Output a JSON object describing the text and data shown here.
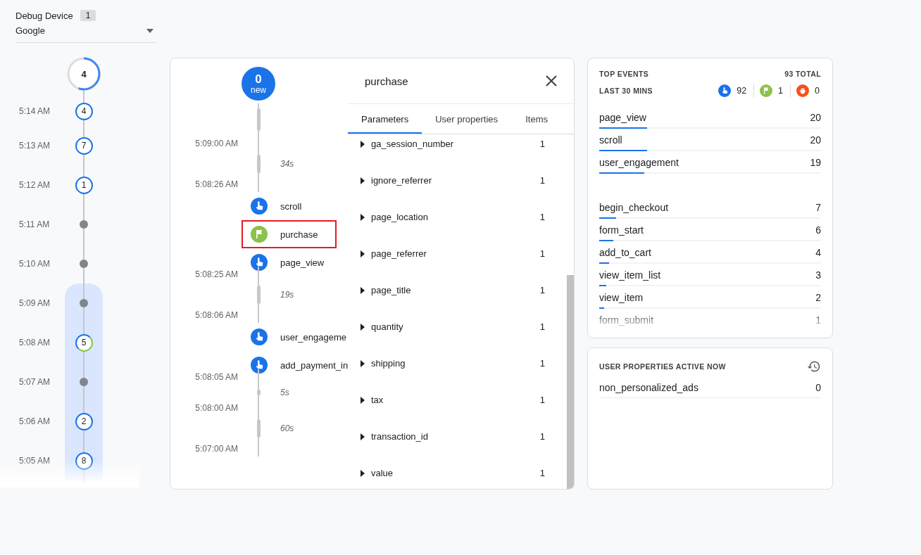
{
  "device": {
    "label": "Debug Device",
    "count": "1",
    "selection": "Google"
  },
  "countdown": {
    "count": "4",
    "level": 0.55
  },
  "minutes": [
    {
      "time": "5:14 AM",
      "kind": "count",
      "count": "4",
      "conversion": false,
      "selected": false
    },
    {
      "time": "5:13 AM",
      "kind": "count",
      "count": "7",
      "conversion": false,
      "selected": false
    },
    {
      "time": "5:12 AM",
      "kind": "count",
      "count": "1",
      "conversion": false,
      "selected": false
    },
    {
      "time": "5:11 AM",
      "kind": "empty",
      "selected": false
    },
    {
      "time": "5:10 AM",
      "kind": "empty",
      "selected": false
    },
    {
      "time": "5:09 AM",
      "kind": "empty",
      "selected": true
    },
    {
      "time": "5:08 AM",
      "kind": "count",
      "count": "5",
      "conversion": true,
      "selected": true
    },
    {
      "time": "5:07 AM",
      "kind": "empty",
      "selected": true
    },
    {
      "time": "5:06 AM",
      "kind": "count",
      "count": "2",
      "conversion": false,
      "selected": true
    },
    {
      "time": "5:05 AM",
      "kind": "count",
      "count": "8",
      "conversion": false,
      "selected": true
    }
  ],
  "stream": {
    "new_count": "0",
    "new_label": "new",
    "entries": [
      {
        "kind": "gap"
      },
      {
        "kind": "time",
        "text": "5:09:00 AM"
      },
      {
        "kind": "gap",
        "text": "34s"
      },
      {
        "kind": "time",
        "text": "5:08:26 AM"
      },
      {
        "kind": "event",
        "name": "scroll",
        "selected": false
      },
      {
        "kind": "conversion",
        "name": "purchase",
        "selected": true
      },
      {
        "kind": "event",
        "name": "page_view",
        "selected": false
      },
      {
        "kind": "time",
        "text": "5:08:25 AM"
      },
      {
        "kind": "gap",
        "text": "19s"
      },
      {
        "kind": "time",
        "text": "5:08:06 AM"
      },
      {
        "kind": "event",
        "name": "user_engageme",
        "selected": false
      },
      {
        "kind": "event",
        "name": "add_payment_in",
        "selected": false
      },
      {
        "kind": "time",
        "text": "5:08:05 AM"
      },
      {
        "kind": "short_gap",
        "text": "5s"
      },
      {
        "kind": "time",
        "text": "5:08:00 AM"
      },
      {
        "kind": "gap",
        "text": "60s"
      },
      {
        "kind": "time",
        "text": "5:07:00 AM"
      }
    ]
  },
  "detail": {
    "title": "purchase",
    "tabs": [
      {
        "label": "Parameters",
        "selected": true
      },
      {
        "label": "User properties",
        "selected": false
      },
      {
        "label": "Items",
        "selected": false
      }
    ],
    "parameters": [
      {
        "name": "ga_session_number",
        "value": "1"
      },
      {
        "name": "ignore_referrer",
        "value": "1"
      },
      {
        "name": "page_location",
        "value": "1"
      },
      {
        "name": "page_referrer",
        "value": "1"
      },
      {
        "name": "page_title",
        "value": "1"
      },
      {
        "name": "quantity",
        "value": "1"
      },
      {
        "name": "shipping",
        "value": "1"
      },
      {
        "name": "tax",
        "value": "1"
      },
      {
        "name": "transaction_id",
        "value": "1"
      },
      {
        "name": "value",
        "value": "1"
      }
    ]
  },
  "top_events": {
    "title": "TOP EVENTS",
    "total": "93 TOTAL",
    "period": "LAST 30 MINS",
    "counters": [
      {
        "kind": "event",
        "count": "92"
      },
      {
        "kind": "conversion",
        "count": "1"
      },
      {
        "kind": "error",
        "count": "0"
      }
    ],
    "groups": [
      [
        {
          "name": "page_view",
          "count": "20",
          "level": 0.215
        },
        {
          "name": "scroll",
          "count": "20",
          "level": 0.215
        },
        {
          "name": "user_engagement",
          "count": "19",
          "level": 0.204
        }
      ],
      [
        {
          "name": "begin_checkout",
          "count": "7",
          "level": 0.075
        },
        {
          "name": "form_start",
          "count": "6",
          "level": 0.065
        },
        {
          "name": "add_to_cart",
          "count": "4",
          "level": 0.043
        },
        {
          "name": "view_item_list",
          "count": "3",
          "level": 0.032
        },
        {
          "name": "view_item",
          "count": "2",
          "level": 0.022
        },
        {
          "name": "form_submit",
          "count": "1",
          "level": 0.011
        }
      ]
    ]
  },
  "user_properties": {
    "title": "USER PROPERTIES ACTIVE NOW",
    "rows": [
      {
        "name": "non_personalized_ads",
        "value": "0"
      }
    ]
  }
}
